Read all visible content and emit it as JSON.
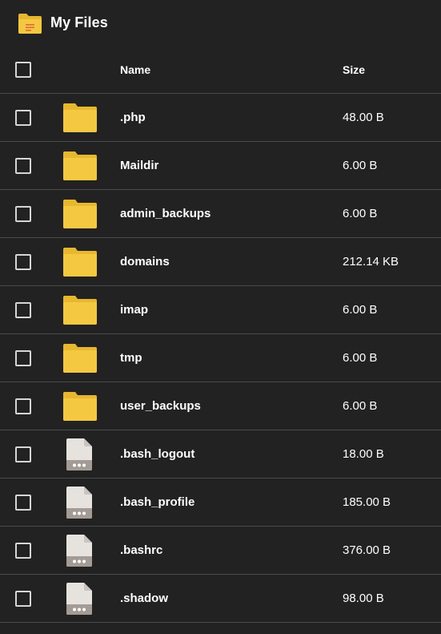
{
  "header": {
    "title": "My Files",
    "icon": "folder-icon"
  },
  "table": {
    "columns": {
      "name": "Name",
      "size": "Size"
    },
    "rows": [
      {
        "name": ".php",
        "size": "48.00 B",
        "type": "folder"
      },
      {
        "name": "Maildir",
        "size": "6.00 B",
        "type": "folder"
      },
      {
        "name": "admin_backups",
        "size": "6.00 B",
        "type": "folder"
      },
      {
        "name": "domains",
        "size": "212.14 KB",
        "type": "folder"
      },
      {
        "name": "imap",
        "size": "6.00 B",
        "type": "folder"
      },
      {
        "name": "tmp",
        "size": "6.00 B",
        "type": "folder"
      },
      {
        "name": "user_backups",
        "size": "6.00 B",
        "type": "folder"
      },
      {
        "name": ".bash_logout",
        "size": "18.00 B",
        "type": "file"
      },
      {
        "name": ".bash_profile",
        "size": "185.00 B",
        "type": "file"
      },
      {
        "name": ".bashrc",
        "size": "376.00 B",
        "type": "file"
      },
      {
        "name": ".shadow",
        "size": "98.00 B",
        "type": "file"
      }
    ]
  },
  "colors": {
    "background": "#222222",
    "folder": "#f5c842",
    "folder_dark": "#e7b730",
    "file": "#e6e3de",
    "file_band": "#a39b95"
  }
}
